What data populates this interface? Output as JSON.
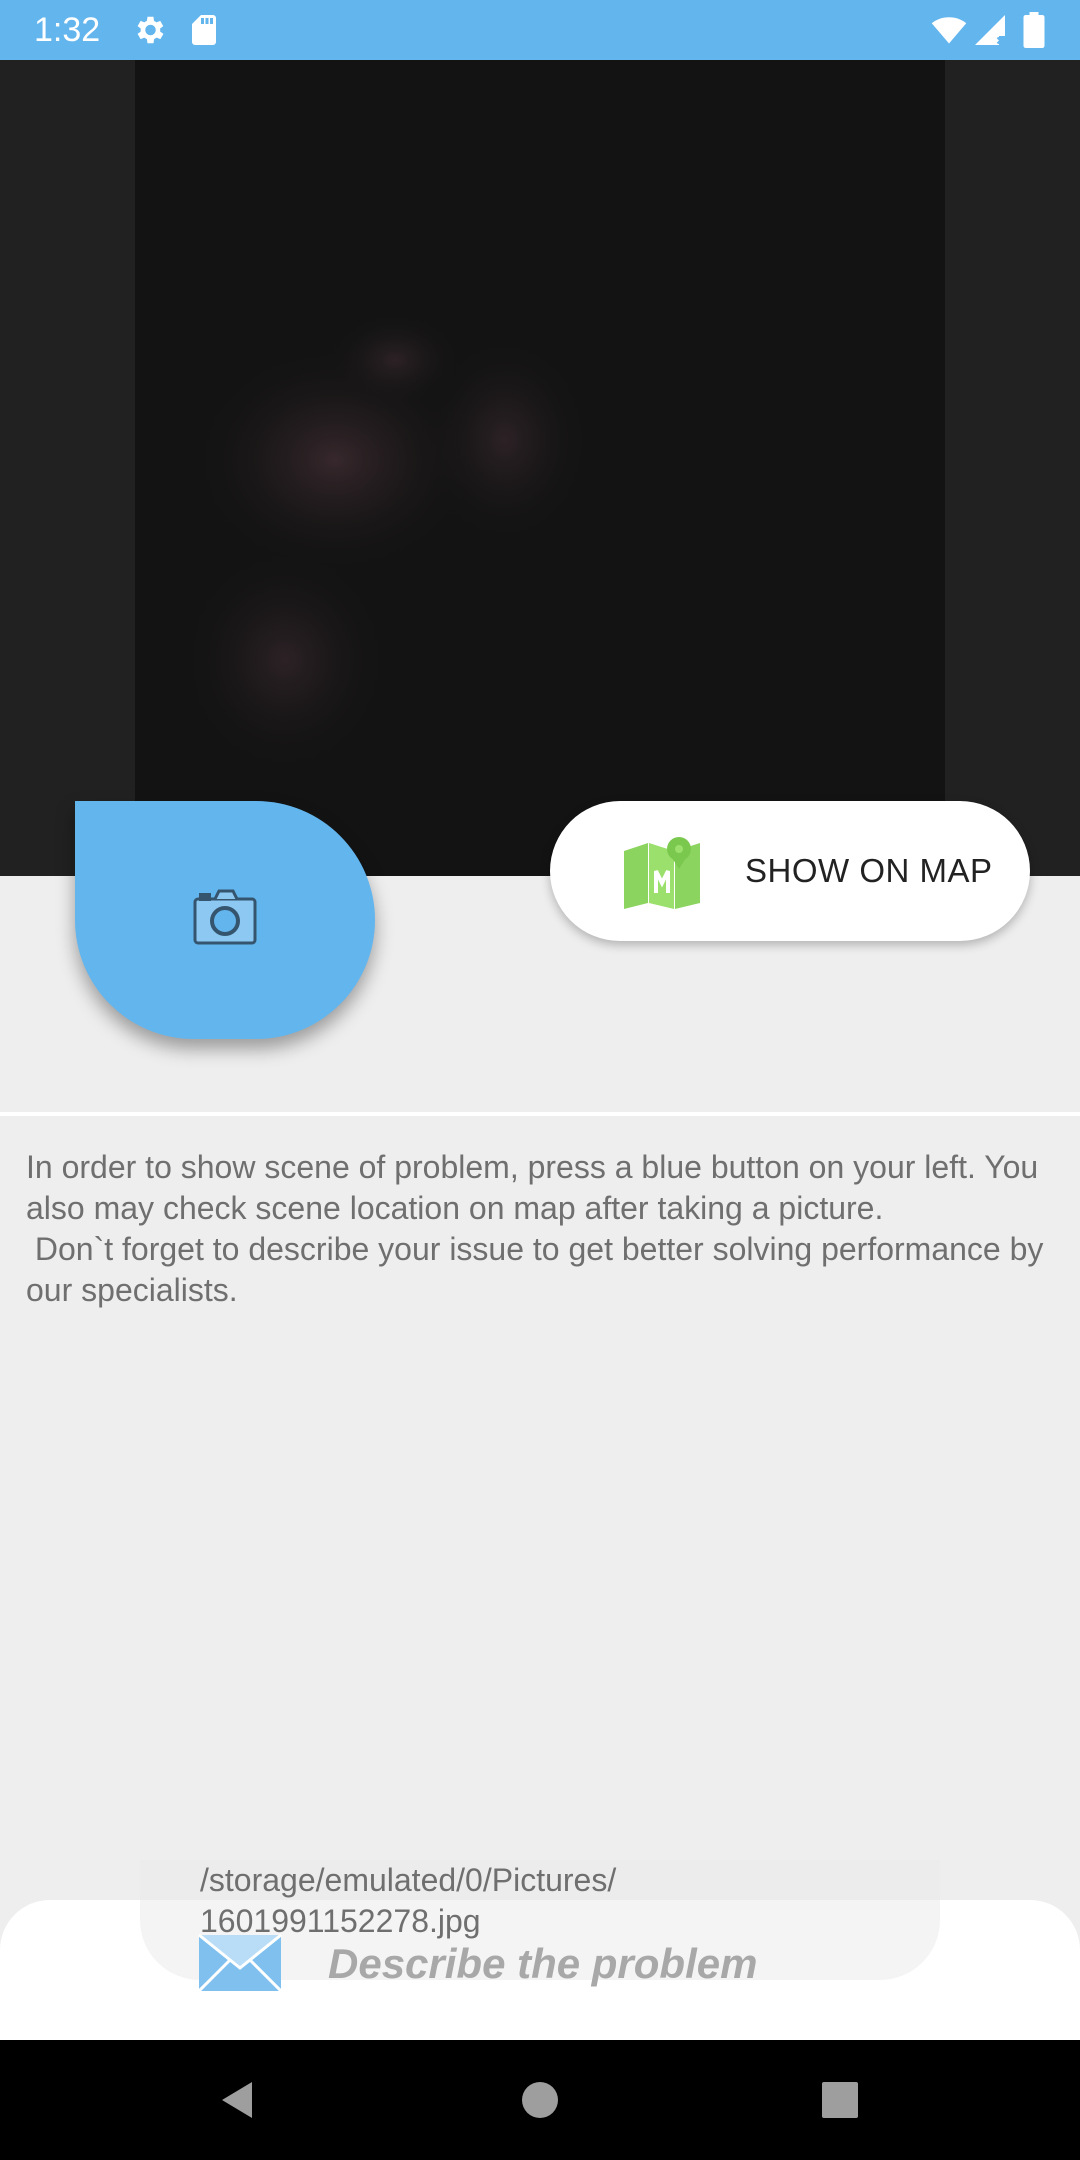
{
  "status_bar": {
    "time": "1:32",
    "icons": [
      "gear-icon",
      "sd-card-icon",
      "wifi-icon",
      "signal-icon",
      "battery-icon"
    ],
    "background": "#63b5ee"
  },
  "camera": {
    "icon": "camera-icon",
    "color": "#63b5ee"
  },
  "map_button": {
    "label": "SHOW ON MAP",
    "icon": "map-icon",
    "icon_color": "#8cd460"
  },
  "instructions": {
    "text": "In order to show scene of problem, press a blue button on your left. You also may check scene location on map after taking a picture.\n Don`t forget to describe your issue to get better solving performance by our specialists."
  },
  "attachment": {
    "file_path": "/storage/emulated/0/Pictures/\n1601991152278.jpg"
  },
  "describe": {
    "icon": "mail-icon",
    "placeholder": "Describe the problem"
  },
  "nav": {
    "buttons": [
      "back-icon",
      "home-icon",
      "recents-icon"
    ]
  }
}
